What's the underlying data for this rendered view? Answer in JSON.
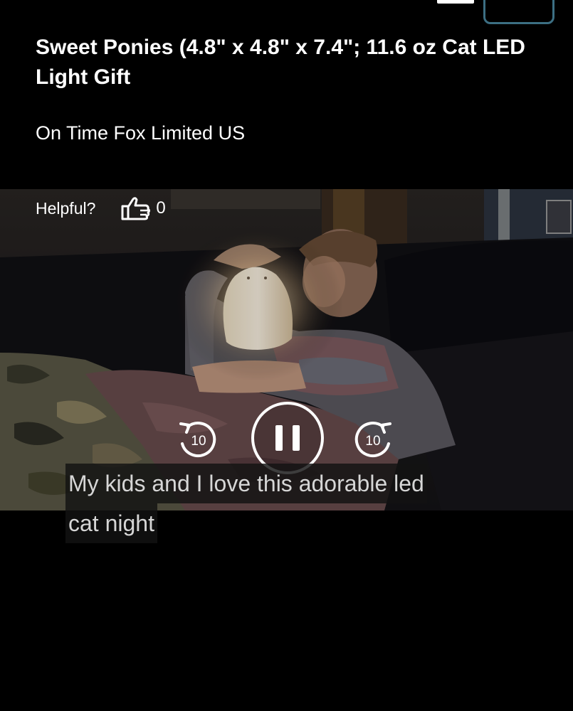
{
  "product": {
    "title": "Sweet Ponies (4.8\" x 4.8\" x 7.4\"; 11.6 oz Cat LED Light Gift",
    "seller": "On Time Fox Limited US"
  },
  "feedback": {
    "helpful_label": "Helpful?",
    "helpful_count": "0"
  },
  "player": {
    "rewind_seconds": "10",
    "forward_seconds": "10",
    "state": "playing",
    "caption_lines": [
      "My kids and I love this adorable led",
      "cat night"
    ]
  },
  "icons": {
    "menu": "menu-icon",
    "thumbs_up": "thumbs-up-icon",
    "rewind": "rewind-10-icon",
    "pause": "pause-icon",
    "forward": "forward-10-icon"
  },
  "colors": {
    "background": "#000000",
    "text": "#ffffff",
    "cart_outline": "#3c6f83",
    "caption_text": "#d6d6d6"
  }
}
